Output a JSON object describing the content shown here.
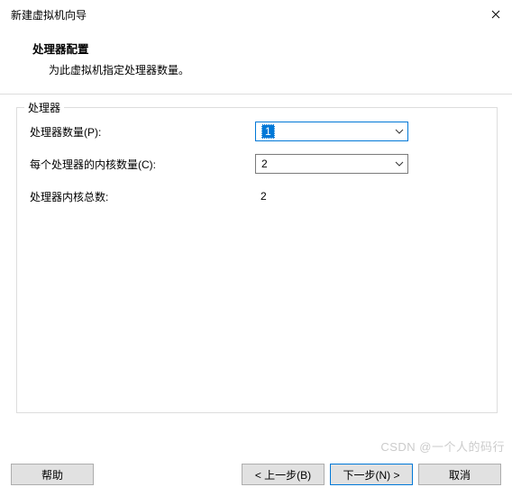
{
  "window": {
    "title": "新建虚拟机向导"
  },
  "header": {
    "title": "处理器配置",
    "subtitle": "为此虚拟机指定处理器数量。"
  },
  "group": {
    "legend": "处理器",
    "rows": {
      "procCount": {
        "label": "处理器数量(P):",
        "value": "1"
      },
      "coresPerProc": {
        "label": "每个处理器的内核数量(C):",
        "value": "2"
      },
      "totalCores": {
        "label": "处理器内核总数:",
        "value": "2"
      }
    }
  },
  "buttons": {
    "help": "帮助",
    "back": "< 上一步(B)",
    "next": "下一步(N) >",
    "cancel": "取消"
  },
  "watermark": "CSDN @一个人的码行"
}
